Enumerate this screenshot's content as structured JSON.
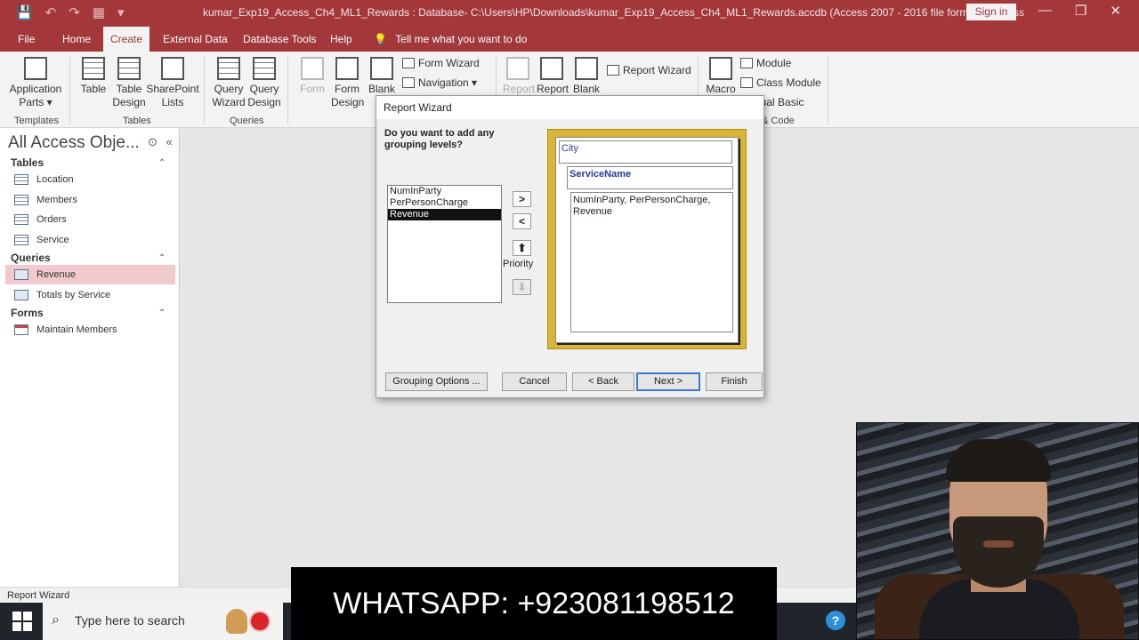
{
  "titlebar": {
    "title": "kumar_Exp19_Access_Ch4_ML1_Rewards : Database- C:\\Users\\HP\\Downloads\\kumar_Exp19_Access_Ch4_ML1_Rewards.accdb (Access 2007 - 2016 file format)  -  Access",
    "signin": "Sign in",
    "qat": [
      "💾",
      "↶",
      "↷",
      "▦",
      "▾"
    ],
    "winctl": [
      "?",
      "—",
      "❐",
      "✕"
    ]
  },
  "tabs": [
    "File",
    "Home",
    "Create",
    "External Data",
    "Database Tools",
    "Help"
  ],
  "active_tab": "Create",
  "tell_me": "Tell me what you want to do",
  "ribbon": {
    "templates": {
      "app_parts": "Application Parts",
      "group": "Templates"
    },
    "tables": {
      "table": "Table",
      "table_design": "Table Design",
      "sharepoint": "SharePoint Lists",
      "group": "Tables"
    },
    "queries": {
      "query_wizard": "Query Wizard",
      "query_design": "Query Design",
      "group": "Queries"
    },
    "forms": {
      "form": "Form",
      "form_design": "Form Design",
      "blank": "Blank F",
      "form_wizard": "Form Wizard",
      "navigation": "Navigation"
    },
    "reports": {
      "report": "Report",
      "report_design": "Report",
      "blank": "Blank",
      "report_wizard": "Report Wizard"
    },
    "macros": {
      "macro": "Macro",
      "module": "Module",
      "class_module": "Class Module",
      "vb": "isual Basic",
      "group": "& Code"
    }
  },
  "nav": {
    "header": "All Access Obje...",
    "sections": [
      {
        "title": "Tables",
        "items": [
          "Location",
          "Members",
          "Orders",
          "Service"
        ]
      },
      {
        "title": "Queries",
        "items": [
          "Revenue",
          "Totals by Service"
        ]
      },
      {
        "title": "Forms",
        "items": [
          "Maintain Members"
        ]
      }
    ],
    "selected": "Revenue"
  },
  "dialog": {
    "title": "Report Wizard",
    "question": "Do you want to add any grouping levels?",
    "fields": [
      "NumInParty",
      "PerPersonCharge",
      "Revenue"
    ],
    "selected_field": "Revenue",
    "arrows": [
      ">",
      "<"
    ],
    "priority_label": "Priority",
    "preview": {
      "level1": "City",
      "level2": "ServiceName",
      "detail": "NumInParty, PerPersonCharge, Revenue"
    },
    "buttons": {
      "grouping": "Grouping Options ...",
      "cancel": "Cancel",
      "back": "< Back",
      "next": "Next >",
      "finish": "Finish"
    }
  },
  "status": "Report Wizard",
  "taskbar": {
    "search_placeholder": "Type here to search"
  },
  "banner": "WHATSAPP: +923081198512",
  "colors": {
    "accent": "#a4373a",
    "selection": "#f2c9cc",
    "preview_frame": "#d8b534"
  }
}
